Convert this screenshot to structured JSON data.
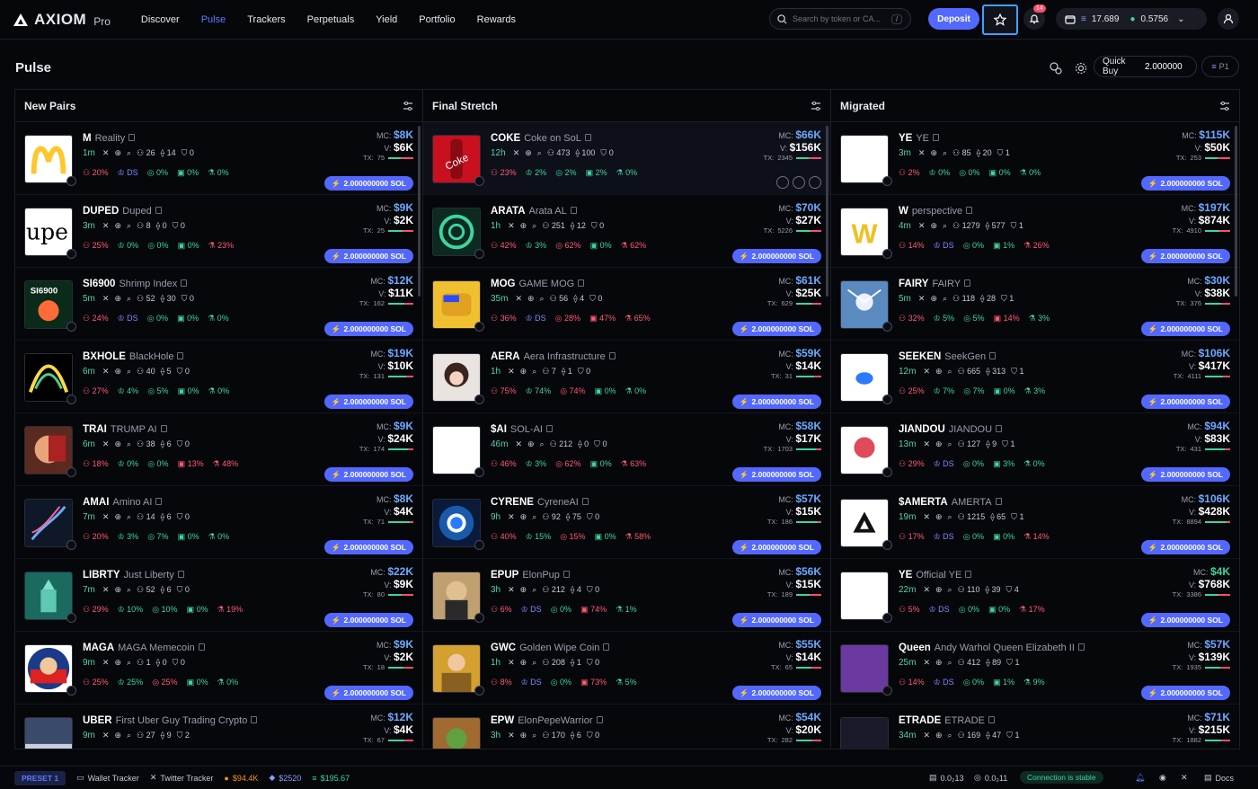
{
  "brand": {
    "name": "AXIOM",
    "suffix": "Pro"
  },
  "nav": [
    "Discover",
    "Pulse",
    "Trackers",
    "Perpetuals",
    "Yield",
    "Portfolio",
    "Rewards"
  ],
  "search": {
    "placeholder": "Search by token or CA...",
    "shortcut": "/"
  },
  "header": {
    "deposit": "Deposit",
    "notifications": "14",
    "balance_sol": "17.689",
    "balance_usd": "0.5756"
  },
  "page": {
    "title": "Pulse",
    "quick_buy_label": "Quick Buy",
    "quick_buy_value": "2.000000",
    "preset": "P1"
  },
  "buy_label": "2.000000000 SOL",
  "columns": [
    {
      "title": "New Pairs",
      "rows": [
        {
          "sym": "M",
          "name": "Reality",
          "age": "1m",
          "m": [
            "26",
            "14",
            "0"
          ],
          "s": [
            "20%",
            "DS",
            "0%",
            "0%",
            "0%"
          ],
          "mc": "$8K",
          "v": "$6K",
          "tx": "75"
        },
        {
          "sym": "DUPED",
          "name": "Duped",
          "age": "3m",
          "m": [
            "8",
            "0",
            "0"
          ],
          "s": [
            "25%",
            "0%",
            "0%",
            "0%",
            "23%"
          ],
          "mc": "$9K",
          "v": "$2K",
          "tx": "25"
        },
        {
          "sym": "SI6900",
          "name": "Shrimp Index",
          "age": "5m",
          "m": [
            "52",
            "30",
            "0"
          ],
          "s": [
            "24%",
            "DS",
            "0%",
            "0%",
            "0%"
          ],
          "mc": "$12K",
          "v": "$11K",
          "tx": "162"
        },
        {
          "sym": "BXHOLE",
          "name": "BlackHole",
          "age": "6m",
          "m": [
            "40",
            "5",
            "0"
          ],
          "s": [
            "27%",
            "4%",
            "5%",
            "0%",
            "0%"
          ],
          "mc": "$19K",
          "v": "$10K",
          "tx": "131"
        },
        {
          "sym": "TRAI",
          "name": "TRUMP AI",
          "age": "6m",
          "m": [
            "38",
            "6",
            "0"
          ],
          "s": [
            "18%",
            "0%",
            "0%",
            "13%",
            "48%"
          ],
          "mc": "$9K",
          "v": "$24K",
          "tx": "174"
        },
        {
          "sym": "AMAI",
          "name": "Amino AI",
          "age": "7m",
          "m": [
            "14",
            "6",
            "0"
          ],
          "s": [
            "20%",
            "3%",
            "7%",
            "0%",
            "0%"
          ],
          "mc": "$8K",
          "v": "$4K",
          "tx": "71"
        },
        {
          "sym": "LIBRTY",
          "name": "Just Liberty",
          "age": "7m",
          "m": [
            "52",
            "6",
            "0"
          ],
          "s": [
            "29%",
            "10%",
            "10%",
            "0%",
            "19%"
          ],
          "mc": "$22K",
          "v": "$9K",
          "tx": "80"
        },
        {
          "sym": "MAGA",
          "name": "MAGA Memecoin",
          "age": "9m",
          "m": [
            "1",
            "0",
            "0"
          ],
          "s": [
            "25%",
            "25%",
            "25%",
            "0%",
            "0%"
          ],
          "mc": "$9K",
          "v": "$2K",
          "tx": "18"
        },
        {
          "sym": "UBER",
          "name": "First Uber Guy Trading Crypto",
          "age": "9m",
          "m": [
            "27",
            "9",
            "2"
          ],
          "s": [
            "",
            "",
            "",
            "",
            ""
          ],
          "mc": "$12K",
          "v": "$4K",
          "tx": "67"
        }
      ]
    },
    {
      "title": "Final Stretch",
      "rows": [
        {
          "sym": "COKE",
          "name": "Coke on SoL",
          "age": "12h",
          "m": [
            "473",
            "100",
            "0"
          ],
          "s": [
            "23%",
            "2%",
            "2%",
            "2%",
            "0%"
          ],
          "mc": "$66K",
          "v": "$156K",
          "tx": "2345"
        },
        {
          "sym": "ARATA",
          "name": "Arata AL",
          "age": "1h",
          "m": [
            "251",
            "12",
            "0"
          ],
          "s": [
            "42%",
            "3%",
            "62%",
            "0%",
            "62%"
          ],
          "mc": "$70K",
          "v": "$27K",
          "tx": "5226"
        },
        {
          "sym": "MOG",
          "name": "GAME MOG",
          "age": "35m",
          "m": [
            "56",
            "4",
            "0"
          ],
          "s": [
            "36%",
            "DS",
            "28%",
            "47%",
            "65%"
          ],
          "mc": "$61K",
          "v": "$25K",
          "tx": "629"
        },
        {
          "sym": "AERA",
          "name": "Aera Infrastructure",
          "age": "1h",
          "m": [
            "7",
            "1",
            "0"
          ],
          "s": [
            "75%",
            "74%",
            "74%",
            "0%",
            "0%"
          ],
          "mc": "$59K",
          "v": "$14K",
          "tx": "31"
        },
        {
          "sym": "$AI",
          "name": "SOL-AI",
          "age": "46m",
          "m": [
            "212",
            "0",
            "0"
          ],
          "s": [
            "46%",
            "3%",
            "62%",
            "0%",
            "63%"
          ],
          "mc": "$58K",
          "v": "$17K",
          "tx": "1703"
        },
        {
          "sym": "CYRENE",
          "name": "CyreneAI",
          "age": "9h",
          "m": [
            "92",
            "75",
            "0"
          ],
          "s": [
            "40%",
            "15%",
            "15%",
            "0%",
            "58%"
          ],
          "mc": "$57K",
          "v": "$15K",
          "tx": "186"
        },
        {
          "sym": "EPUP",
          "name": "ElonPup",
          "age": "3h",
          "m": [
            "212",
            "4",
            "0"
          ],
          "s": [
            "6%",
            "DS",
            "0%",
            "74%",
            "1%"
          ],
          "mc": "$56K",
          "v": "$15K",
          "tx": "189"
        },
        {
          "sym": "GWC",
          "name": "Golden Wipe Coin",
          "age": "1h",
          "m": [
            "208",
            "1",
            "0"
          ],
          "s": [
            "8%",
            "DS",
            "0%",
            "73%",
            "5%"
          ],
          "mc": "$55K",
          "v": "$14K",
          "tx": "65"
        },
        {
          "sym": "EPW",
          "name": "ElonPepeWarrior",
          "age": "3h",
          "m": [
            "170",
            "6",
            "0"
          ],
          "s": [
            "",
            "",
            "",
            "",
            ""
          ],
          "mc": "$54K",
          "v": "$20K",
          "tx": "282"
        }
      ]
    },
    {
      "title": "Migrated",
      "rows": [
        {
          "sym": "YE",
          "name": "YE",
          "age": "3m",
          "m": [
            "85",
            "20",
            "1"
          ],
          "s": [
            "2%",
            "0%",
            "0%",
            "0%",
            "0%"
          ],
          "mc": "$115K",
          "v": "$50K",
          "tx": "253"
        },
        {
          "sym": "W",
          "name": "perspective",
          "age": "4m",
          "m": [
            "1279",
            "577",
            "1"
          ],
          "s": [
            "14%",
            "DS",
            "0%",
            "1%",
            "26%"
          ],
          "mc": "$197K",
          "v": "$874K",
          "tx": "4910"
        },
        {
          "sym": "FAIRY",
          "name": "FAIRY",
          "age": "5m",
          "m": [
            "118",
            "28",
            "1"
          ],
          "s": [
            "32%",
            "5%",
            "5%",
            "14%",
            "3%"
          ],
          "mc": "$30K",
          "v": "$38K",
          "tx": "376"
        },
        {
          "sym": "SEEKEN",
          "name": "SeekGen",
          "age": "12m",
          "m": [
            "665",
            "313",
            "1"
          ],
          "s": [
            "25%",
            "7%",
            "7%",
            "0%",
            "3%"
          ],
          "mc": "$106K",
          "v": "$417K",
          "tx": "4111"
        },
        {
          "sym": "JIANDOU",
          "name": "JIANDOU",
          "age": "13m",
          "m": [
            "127",
            "9",
            "1"
          ],
          "s": [
            "29%",
            "DS",
            "0%",
            "3%",
            "0%"
          ],
          "mc": "$94K",
          "v": "$83K",
          "tx": "431"
        },
        {
          "sym": "$AMERTA",
          "name": "AMERTA",
          "age": "19m",
          "m": [
            "1215",
            "65",
            "1"
          ],
          "s": [
            "17%",
            "DS",
            "0%",
            "0%",
            "14%"
          ],
          "mc": "$106K",
          "v": "$428K",
          "tx": "8894"
        },
        {
          "sym": "YE",
          "name": "Official YE",
          "age": "22m",
          "m": [
            "110",
            "39",
            "4"
          ],
          "s": [
            "5%",
            "DS",
            "0%",
            "0%",
            "17%"
          ],
          "mc": "$4K",
          "v": "$768K",
          "tx": "3386"
        },
        {
          "sym": "Queen",
          "name": "Andy Warhol Queen Elizabeth II",
          "age": "25m",
          "m": [
            "412",
            "89",
            "1"
          ],
          "s": [
            "14%",
            "DS",
            "0%",
            "1%",
            "9%"
          ],
          "mc": "$57K",
          "v": "$139K",
          "tx": "1935"
        },
        {
          "sym": "ETRADE",
          "name": "ETRADE",
          "age": "34m",
          "m": [
            "169",
            "47",
            "1"
          ],
          "s": [
            "",
            "",
            "",
            "",
            ""
          ],
          "mc": "$71K",
          "v": "$215K",
          "tx": "1882"
        }
      ]
    }
  ],
  "footer": {
    "preset": "PRESET 1",
    "wallet_tracker": "Wallet Tracker",
    "twitter_tracker": "Twitter Tracker",
    "btc": "$94.4K",
    "eth": "$2520",
    "sol": "$195.67",
    "gas1": "0.0₂13",
    "gas2": "0.0₂11",
    "connection": "Connection is stable",
    "docs": "Docs"
  }
}
